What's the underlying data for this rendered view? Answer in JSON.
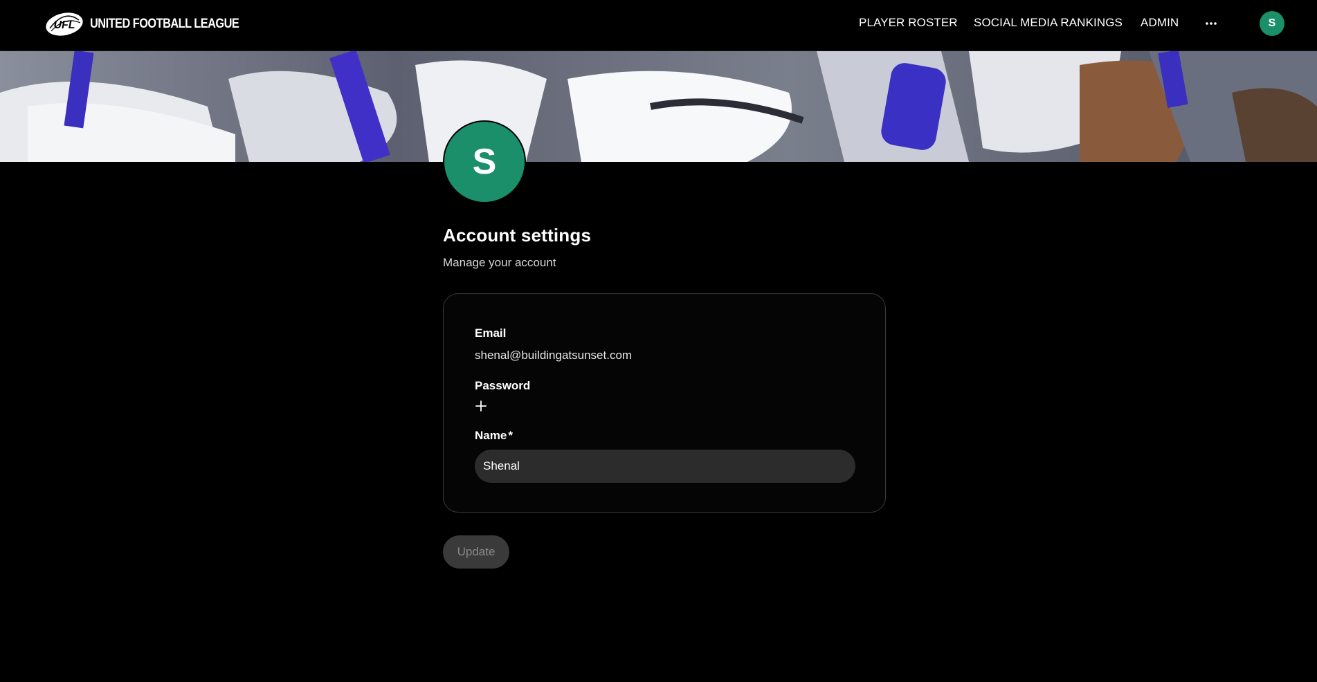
{
  "header": {
    "brand_name": "UNITED FOOTBALL LEAGUE",
    "logo_mark_text": "UFL",
    "nav": [
      {
        "label": "PLAYER ROSTER"
      },
      {
        "label": "SOCIAL MEDIA RANKINGS"
      },
      {
        "label": "ADMIN"
      }
    ],
    "more_icon": "ellipsis-icon",
    "user_initial": "S"
  },
  "banner": {
    "kind": "football-players-photo"
  },
  "profile": {
    "initial": "S",
    "avatar_color": "#1a8f6a"
  },
  "page": {
    "title": "Account settings",
    "subtitle": "Manage your account"
  },
  "form": {
    "email_label": "Email",
    "email_value": "shenal@buildingatsunset.com",
    "password_label": "Password",
    "password_action_icon": "plus-icon",
    "name_label": "Name",
    "name_required_mark": "*",
    "name_value": "Shenal"
  },
  "actions": {
    "update_label": "Update"
  },
  "colors": {
    "background": "#000000",
    "accent": "#1a8f6a",
    "input_bg": "#2c2c2c",
    "button_disabled_bg": "#3a3a3a",
    "button_disabled_text": "#8a8a8a"
  }
}
